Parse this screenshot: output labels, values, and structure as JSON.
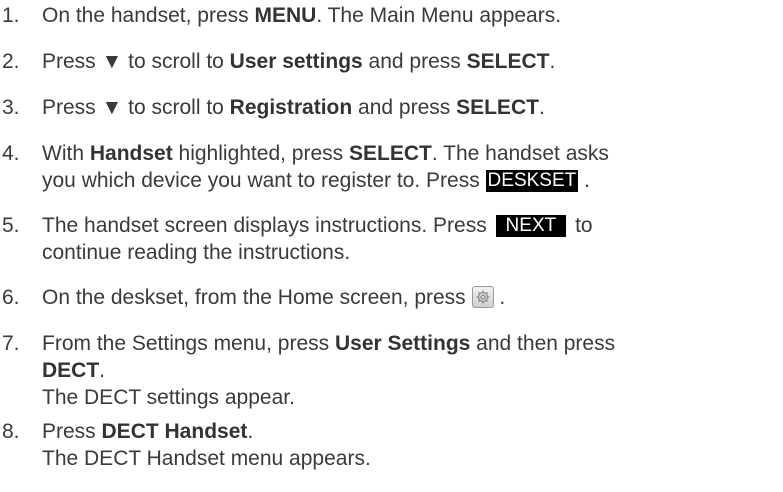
{
  "steps": [
    {
      "num": "1.",
      "lines": [
        {
          "t1": "On the handset, press ",
          "b1": "MENU",
          "t2": ". The Main Menu appears."
        }
      ]
    },
    {
      "num": "2.",
      "lines": [
        {
          "t1": "Press ▼ to scroll to ",
          "b1": "User settings",
          "t2": " and press ",
          "b2": "SELECT",
          "t3": "."
        }
      ]
    },
    {
      "num": "3.",
      "lines": [
        {
          "t1": "Press ▼ to scroll to ",
          "b1": "Registration",
          "t2": " and press ",
          "b2": "SELECT",
          "t3": "."
        }
      ]
    },
    {
      "num": "4.",
      "lines": [
        {
          "t1": "With ",
          "b1": "Handset",
          "t2": " highlighted, press ",
          "b2": "SELECT",
          "t3": ". The handset asks"
        },
        {
          "t1": "you which device you want to register to. Press ",
          "key": "DESKSET",
          "t2": " ."
        }
      ]
    },
    {
      "num": "5.",
      "lines": [
        {
          "t1": "The handset screen displays instructions. Press ",
          "key": "NEXT",
          "t2": " to"
        },
        {
          "t1": "continue reading the instructions."
        }
      ]
    },
    {
      "num": "6.",
      "lines": [
        {
          "t1": "On the deskset, from the Home screen, press ",
          "icon": "settings-gear-icon",
          "t2": " ."
        }
      ]
    },
    {
      "num": "7.",
      "lines": [
        {
          "t1": "From the Settings menu, press ",
          "b1": "User Settings",
          "t2": " and then press"
        },
        {
          "b1": "DECT",
          "t2": "."
        },
        {
          "t1": "The DECT settings appear."
        }
      ]
    },
    {
      "num": "8.",
      "lines": [
        {
          "t1": "Press ",
          "b1": "DECT Handset",
          "t2": "."
        },
        {
          "t1": "The DECT Handset menu appears."
        }
      ]
    }
  ]
}
